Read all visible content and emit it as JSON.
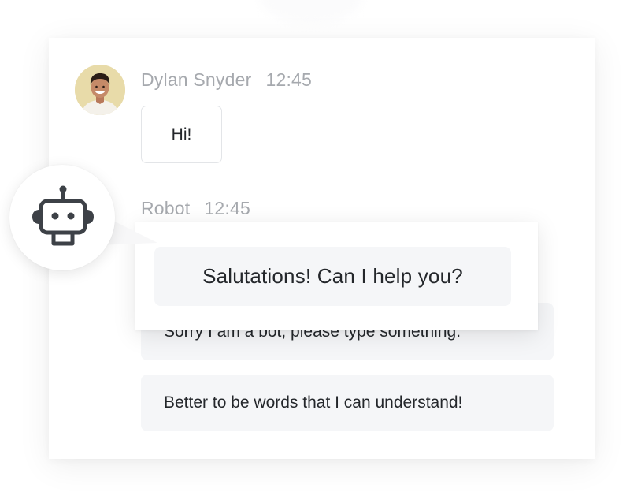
{
  "user": {
    "name": "Dylan Snyder",
    "time": "12:45",
    "message": "Hi!"
  },
  "robot": {
    "name": "Robot",
    "time": "12:45",
    "icon": "robot-icon",
    "popup_message": "Salutations! Can I help you?",
    "messages": [
      "Sorry I am a bot, please type something.",
      "Better to be words that I can understand!"
    ]
  },
  "colors": {
    "meta_text": "#a6a9ae",
    "message_text": "#24272b",
    "bubble_bg": "#f5f6f8",
    "icon_color": "#3d4147"
  }
}
